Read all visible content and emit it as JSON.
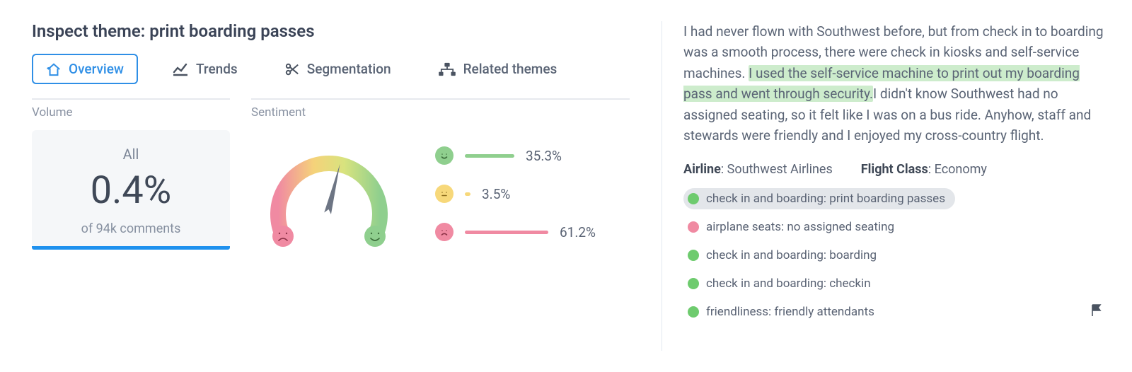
{
  "header": {
    "title": "Inspect theme: print boarding passes"
  },
  "tabs": [
    {
      "label": "Overview",
      "icon": "home-icon",
      "active": true
    },
    {
      "label": "Trends",
      "icon": "chart-line-icon",
      "active": false
    },
    {
      "label": "Segmentation",
      "icon": "scissors-icon",
      "active": false
    },
    {
      "label": "Related themes",
      "icon": "diagram-icon",
      "active": false
    }
  ],
  "volume": {
    "section_label": "Volume",
    "scope": "All",
    "value": "0.4%",
    "subtitle": "of 94k comments"
  },
  "sentiment": {
    "section_label": "Sentiment",
    "positive": {
      "pct": 35.3,
      "label": "35.3%",
      "color": "#8fcf8e"
    },
    "neutral": {
      "pct": 3.5,
      "label": "3.5%",
      "color": "#f7d87a"
    },
    "negative": {
      "pct": 61.2,
      "label": "61.2%",
      "color": "#f08aa2"
    }
  },
  "review": {
    "text_pre": "I had never flown with Southwest before, but from check in to boarding was a smooth process, there were check in kiosks and self-service machines. ",
    "text_hl": "I used the self-service machine to print out my boarding pass and went through security.",
    "text_post": "I didn't know Southwest had no assigned seating, so it felt like I was on a bus ride. Anyhow, staff and stewards were friendly and I enjoyed my cross-country flight.",
    "meta": {
      "airline_label": "Airline",
      "airline_value": "Southwest Airlines",
      "class_label": "Flight Class",
      "class_value": "Economy"
    },
    "tags": [
      {
        "label": "check in and boarding: print boarding passes",
        "sent": "green",
        "selected": true
      },
      {
        "label": "airplane seats: no assigned seating",
        "sent": "pink",
        "selected": false
      },
      {
        "label": "check in and boarding: boarding",
        "sent": "green",
        "selected": false
      },
      {
        "label": "check in and boarding: checkin",
        "sent": "green",
        "selected": false
      },
      {
        "label": "friendliness: friendly attendants",
        "sent": "green",
        "selected": false
      }
    ]
  },
  "chart_data": {
    "type": "pie",
    "title": "Sentiment",
    "categories": [
      "Positive",
      "Neutral",
      "Negative"
    ],
    "values": [
      35.3,
      3.5,
      61.2
    ],
    "colors": [
      "#8fcf8e",
      "#f7d87a",
      "#f08aa2"
    ]
  }
}
